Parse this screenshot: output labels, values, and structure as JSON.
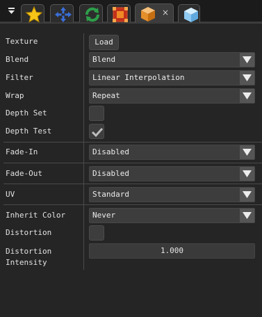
{
  "tabs": [
    {
      "icon": "star-icon",
      "active": false
    },
    {
      "icon": "move-arrows-icon",
      "active": false
    },
    {
      "icon": "rotate-icon",
      "active": false
    },
    {
      "icon": "scale-icon",
      "active": false
    },
    {
      "icon": "box-orange-icon",
      "active": true,
      "close_label": "×"
    },
    {
      "icon": "box-blue-icon",
      "active": false
    }
  ],
  "properties": {
    "texture": {
      "label": "Texture",
      "button": "Load"
    },
    "blend": {
      "label": "Blend",
      "value": "Blend"
    },
    "filter": {
      "label": "Filter",
      "value": "Linear Interpolation"
    },
    "wrap": {
      "label": "Wrap",
      "value": "Repeat"
    },
    "depth_set": {
      "label": "Depth Set",
      "checked": false
    },
    "depth_test": {
      "label": "Depth Test",
      "checked": true
    },
    "fade_in": {
      "label": "Fade-In",
      "value": "Disabled"
    },
    "fade_out": {
      "label": "Fade-Out",
      "value": "Disabled"
    },
    "uv": {
      "label": "UV",
      "value": "Standard"
    },
    "inherit_color": {
      "label": "Inherit Color",
      "value": "Never"
    },
    "distortion": {
      "label": "Distortion",
      "checked": false
    },
    "distortion_intensity": {
      "label_line1": "Distortion",
      "label_line2": "Intensity",
      "value": "1.000"
    }
  },
  "colors": {
    "background": "#252526",
    "field": "#3d3d3d",
    "arrow_box": "#555555"
  }
}
